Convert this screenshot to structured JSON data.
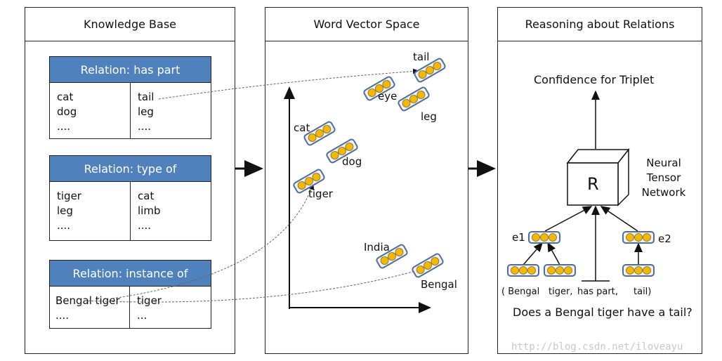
{
  "panels": {
    "knowledge_base": {
      "title": "Knowledge Base"
    },
    "word_vector_space": {
      "title": "Word Vector Space"
    },
    "reasoning": {
      "title": "Reasoning about Relations"
    }
  },
  "relations": [
    {
      "title": "Relation: has part",
      "left": [
        "cat",
        "dog",
        "...."
      ],
      "right": [
        "tail",
        "leg",
        "...."
      ]
    },
    {
      "title": "Relation: type of",
      "left": [
        "tiger",
        "leg",
        "...."
      ],
      "right": [
        "cat",
        "limb",
        "...."
      ]
    },
    {
      "title": "Relation: instance of",
      "left": [
        "Bengal tiger",
        "...."
      ],
      "right": [
        "tiger",
        "..."
      ]
    }
  ],
  "words": {
    "tail": "tail",
    "eye": "eye",
    "leg": "leg",
    "cat": "cat",
    "dog": "dog",
    "tiger": "tiger",
    "india": "India",
    "bengal": "Bengal"
  },
  "reasoning": {
    "confidence": "Confidence for Triplet",
    "cube_label": "R",
    "network": [
      "Neural",
      "Tensor",
      "Network"
    ],
    "e1": "e1",
    "e2": "e2",
    "triplet": [
      "( Bengal",
      "tiger,",
      "has part,",
      "tail)"
    ],
    "question": "Does a Bengal tiger have a tail?"
  },
  "colors": {
    "header_blue": "#4f81bd",
    "node_yellow": "#f5b800",
    "vector_outline": "#4f6f9a"
  },
  "watermark": "http://blog.csdn.net/iloveayu"
}
